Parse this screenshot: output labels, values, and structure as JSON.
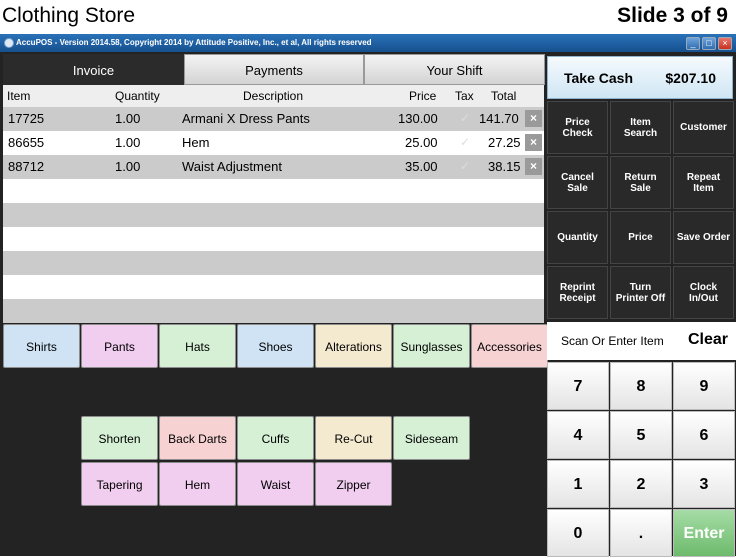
{
  "slide": {
    "title": "Clothing Store",
    "number": "Slide 3 of 9"
  },
  "window": {
    "title": "AccuPOS - Version 2014.58, Copyright 2014 by Attitude Positive, Inc., et al, All rights reserved",
    "min": "_",
    "max": "□",
    "close": "×"
  },
  "tabs": [
    "Invoice",
    "Payments",
    "Your Shift"
  ],
  "table": {
    "headers": {
      "item": "Item",
      "quantity": "Quantity",
      "description": "Description",
      "price": "Price",
      "tax": "Tax",
      "total": "Total"
    },
    "rows": [
      {
        "item": "17725",
        "quantity": "1.00",
        "description": "Armani X Dress Pants",
        "price": "130.00",
        "tax": "✓",
        "total": "141.70",
        "remove": "×"
      },
      {
        "item": "86655",
        "quantity": "1.00",
        "description": "Hem",
        "price": "25.00",
        "tax": "✓",
        "total": "27.25",
        "remove": "×"
      },
      {
        "item": "88712",
        "quantity": "1.00",
        "description": "Waist Adjustment",
        "price": "35.00",
        "tax": "✓",
        "total": "38.15",
        "remove": "×"
      }
    ]
  },
  "categories": [
    {
      "label": "Shirts",
      "color": "#cfe3f5"
    },
    {
      "label": "Pants",
      "color": "#f1cdf0"
    },
    {
      "label": "Hats",
      "color": "#d5f0d5"
    },
    {
      "label": "Shoes",
      "color": "#cfe3f5"
    },
    {
      "label": "Alterations",
      "color": "#f4ead0"
    },
    {
      "label": "Sunglasses",
      "color": "#d5f0d5"
    },
    {
      "label": "Accessories",
      "color": "#f6d2d2"
    }
  ],
  "subcategories": [
    {
      "label": "Shorten",
      "color": "#d5f0d5"
    },
    {
      "label": "Back Darts",
      "color": "#f6d2d2"
    },
    {
      "label": "Cuffs",
      "color": "#d5f0d5"
    },
    {
      "label": "Re-Cut",
      "color": "#f4ead0"
    },
    {
      "label": "Sideseam",
      "color": "#d5f0d5"
    },
    {
      "label": "Tapering",
      "color": "#f1cdf0"
    },
    {
      "label": "Hem",
      "color": "#f1cdf0"
    },
    {
      "label": "Waist",
      "color": "#f1cdf0"
    },
    {
      "label": "Zipper",
      "color": "#f1cdf0"
    }
  ],
  "take_cash": {
    "label": "Take Cash",
    "amount": "$207.10"
  },
  "functions": [
    [
      "Price",
      "Check"
    ],
    [
      "Item",
      "Search"
    ],
    [
      "Customer",
      ""
    ],
    [
      "Cancel",
      "Sale"
    ],
    [
      "Return",
      "Sale"
    ],
    [
      "Repeat",
      "Item"
    ],
    [
      "Quantity",
      ""
    ],
    [
      "Price",
      ""
    ],
    [
      "Save Order",
      ""
    ],
    [
      "Reprint",
      "Receipt"
    ],
    [
      "Turn",
      "Printer Off"
    ],
    [
      "Clock",
      "In/Out"
    ]
  ],
  "scan": {
    "placeholder": "Scan Or Enter Item",
    "clear": "Clear"
  },
  "keypad": [
    "7",
    "8",
    "9",
    "4",
    "5",
    "6",
    "1",
    "2",
    "3",
    "0",
    ".",
    "Enter"
  ]
}
